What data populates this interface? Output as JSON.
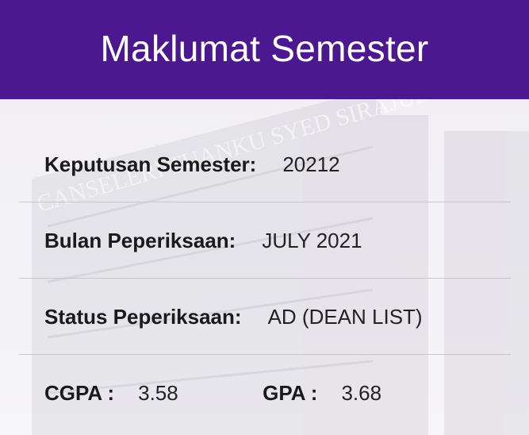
{
  "header": {
    "title": "Maklumat Semester",
    "color": "#4b1890"
  },
  "details": {
    "keputusan_label": "Keputusan Semester:",
    "keputusan_value": "20212",
    "bulan_label": "Bulan Peperiksaan:",
    "bulan_value": "JULY 2021",
    "status_label": "Status Peperiksaan:",
    "status_value": "AD (DEAN LIST)",
    "cgpa_label": "CGPA :",
    "cgpa_value": "3.58",
    "gpa_label": "GPA :",
    "gpa_value": "3.68"
  },
  "background": {
    "watermark_text": "CANSELERI TUANKU SYED SIRAJUDDIN"
  }
}
